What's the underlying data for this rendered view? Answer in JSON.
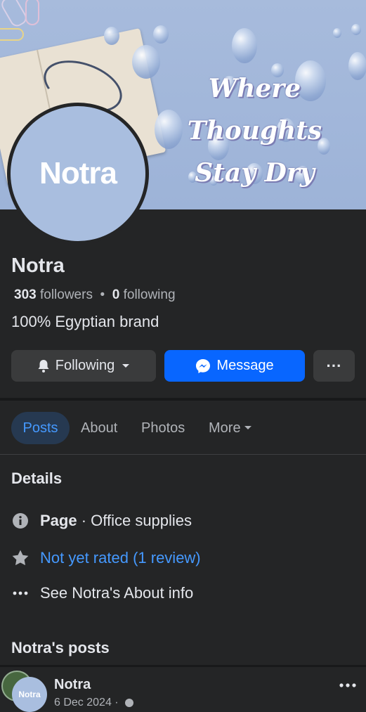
{
  "cover": {
    "tagline_line1": "Where Thoughts",
    "tagline_line2": "Stay Dry"
  },
  "profile": {
    "logo_text": "Notra",
    "name": "Notra",
    "followers_count": "303",
    "followers_label": "followers",
    "following_count": "0",
    "following_label": "following",
    "bio": "100% Egyptian brand"
  },
  "actions": {
    "following_label": "Following",
    "message_label": "Message",
    "more_label": "···"
  },
  "tabs": [
    {
      "label": "Posts"
    },
    {
      "label": "About"
    },
    {
      "label": "Photos"
    },
    {
      "label": "More"
    }
  ],
  "details": {
    "title": "Details",
    "category_prefix": "Page",
    "category": " · Office supplies",
    "rating": "Not yet rated (1 review)",
    "about_link": "See Notra's About info"
  },
  "posts": {
    "title": "Notra's posts",
    "author": "Notra",
    "avatar_text": "Notra",
    "date": "6 Dec 2024 ·"
  },
  "colors": {
    "background": "#242526",
    "accent": "#0866ff",
    "link": "#4599ff",
    "cover": "#9db3d8"
  }
}
